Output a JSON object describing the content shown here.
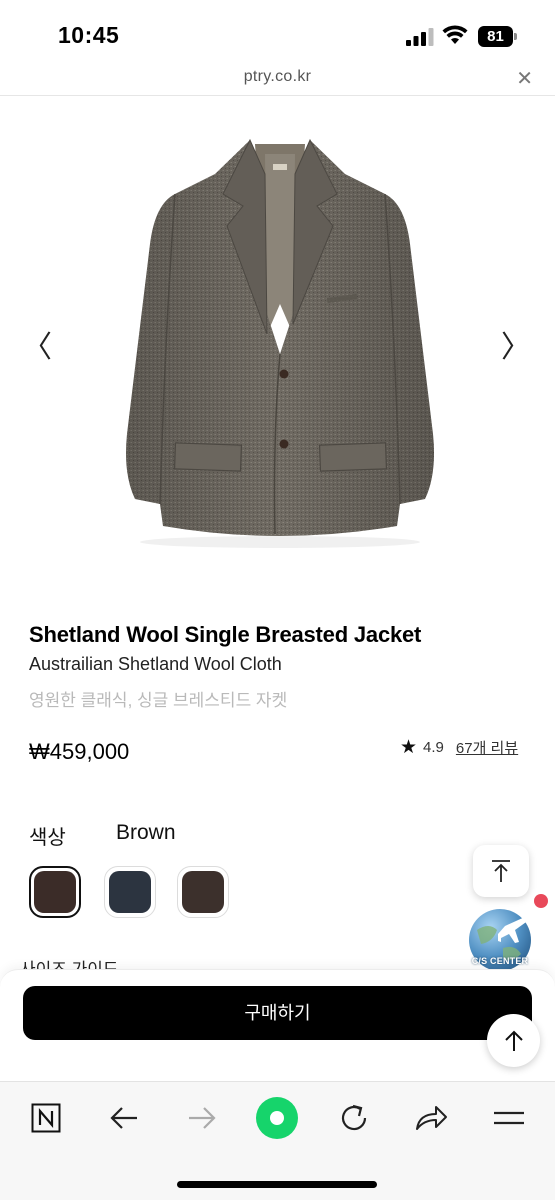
{
  "status_bar": {
    "time": "10:45",
    "battery": "81",
    "icons": [
      "signal-icon",
      "wifi-icon",
      "battery-icon"
    ]
  },
  "url_bar": {
    "url": "ptry.co.kr",
    "close_label": "✕"
  },
  "carousel": {
    "prev_label": "〈",
    "next_label": "〉"
  },
  "product": {
    "title": "Shetland Wool Single Breasted Jacket",
    "subtitle": "Austrailian Shetland Wool Cloth",
    "kr_description": "영원한 클래식, 싱글 브레스티드 자켓",
    "price": "₩459,000",
    "rating": "4.9",
    "reviews": "67개 리뷰"
  },
  "options": {
    "color_label": "색상",
    "selected_color": "Brown",
    "swatches": [
      {
        "name": "brown",
        "color": "#3b2c28",
        "selected": true
      },
      {
        "name": "navy",
        "color": "#2c3440",
        "selected": false
      },
      {
        "name": "dark-brown",
        "color": "#3c302c",
        "selected": false
      }
    ],
    "size_guide_label": "사이즈 가이드"
  },
  "floating": {
    "cs_label": "C/S CENTER"
  },
  "buy": {
    "button_label": "구매하기"
  },
  "toolbar": {
    "icons": [
      "naver-icon",
      "back-icon",
      "forward-icon",
      "green-dot-icon",
      "reload-icon",
      "share-icon",
      "menu-icon"
    ],
    "accent_green": "#16d46b"
  }
}
